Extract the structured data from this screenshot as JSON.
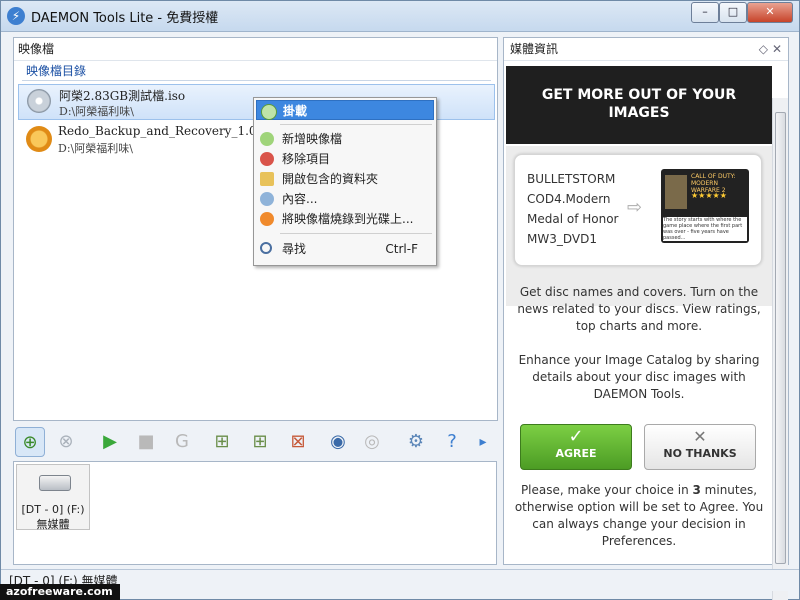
{
  "window": {
    "title": "DAEMON Tools Lite - 免費授權",
    "min": "–",
    "max": "□",
    "close": "✕"
  },
  "images_panel": {
    "header": "映像檔",
    "subheader": "映像檔目錄",
    "items": [
      {
        "name": "阿榮2.83GB測試檔.iso",
        "path": "D:\\阿榮福利味\\"
      },
      {
        "name": "Redo_Backup_and_Recovery_1.0.2.iso",
        "path": "D:\\阿榮福利味\\"
      }
    ]
  },
  "context_menu": {
    "items": [
      {
        "label": "掛載",
        "icon": "mount-icon"
      },
      {
        "label": "新增映像檔",
        "icon": "add-image-icon"
      },
      {
        "label": "移除項目",
        "icon": "remove-icon"
      },
      {
        "label": "開啟包含的資料夾",
        "icon": "folder-icon"
      },
      {
        "label": "內容...",
        "icon": "properties-icon"
      },
      {
        "label": "將映像檔燒錄到光碟上...",
        "icon": "burn-icon"
      },
      {
        "label": "尋找",
        "icon": "search-icon",
        "shortcut": "Ctrl-F"
      }
    ]
  },
  "drive": {
    "label": "[DT - 0] (F:)",
    "status": "無媒體"
  },
  "statusbar": "[DT - 0] (F:) 無媒體",
  "watermark": "azofreeware.com",
  "media_panel": {
    "header": "媒體資訊",
    "banner": "GET MORE OUT OF YOUR IMAGES",
    "promo_list": [
      "BULLETSTORM",
      "COD4.Modern",
      "Medal of Honor",
      "MW3_DVD1"
    ],
    "promo_card_title": "CALL OF DUTY: MODERN WARFARE 2",
    "promo_card_text": "The story starts with where the game place where the first part was over - five years have passed...",
    "promo_card_link": "Read more",
    "info1": "Get disc names and covers. Turn on the news related to your discs. View ratings, top charts and more.",
    "info2": "Enhance your Image Catalog by sharing details about your disc images with DAEMON Tools.",
    "agree": "AGREE",
    "no_thanks": "NO THANKS",
    "choice_before": "Please, make your choice in ",
    "choice_minutes": "3",
    "choice_after": " minutes, otherwise option will be set to Agree. You can always change your decision in Preferences."
  }
}
